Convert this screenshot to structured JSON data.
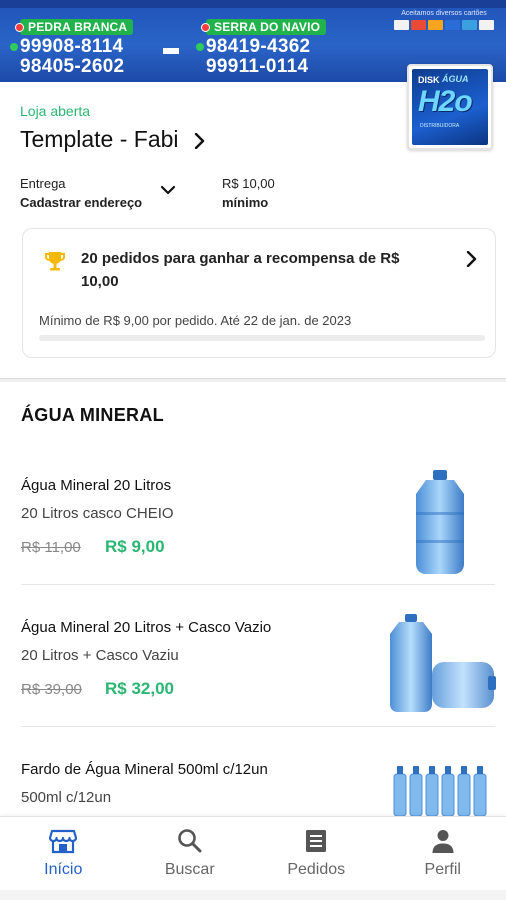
{
  "banner": {
    "left": {
      "city": "PEDRA BRANCA",
      "phones": [
        "99908-8114",
        "98405-2602"
      ]
    },
    "right": {
      "city": "SERRA DO NAVIO",
      "phones": [
        "98419-4362",
        "99911-0114"
      ]
    },
    "cards_caption": "Aceitamos diversos cartões",
    "card_colors": [
      "#f2f2f2",
      "#e94b35",
      "#f7a51e",
      "#2a6dd9",
      "#3aa0e0",
      "#f2f2f2"
    ]
  },
  "logo": {
    "line1": "DISK",
    "line2": "ÁGUA",
    "big": "H2o",
    "sub": "DISTRIBUIDORA"
  },
  "store": {
    "status": "Loja aberta",
    "name": "Template - Fabi",
    "delivery_label": "Entrega",
    "delivery_action": "Cadastrar endereço",
    "min_value": "R$ 10,00",
    "min_label": "mínimo"
  },
  "reward": {
    "title": "20 pedidos para ganhar a recompensa de R$ 10,00",
    "note": "Mínimo de R$ 9,00 por pedido. Até 22 de jan. de 2023",
    "progress": 0
  },
  "section": {
    "title": "ÁGUA MINERAL"
  },
  "products": [
    {
      "name": "Água Mineral 20 Litros",
      "desc": "20 Litros casco CHEIO",
      "old_price": "R$ 11,00",
      "price": "R$ 9,00"
    },
    {
      "name": "Água Mineral 20 Litros + Casco Vazio",
      "desc": "20 Litros + Casco Vaziu",
      "old_price": "R$ 39,00",
      "price": "R$ 32,00"
    },
    {
      "name": "Fardo de Água Mineral 500ml c/12un",
      "desc": "500ml c/12un",
      "old_price": "",
      "price": ""
    }
  ],
  "nav": [
    {
      "label": "Início",
      "icon": "store-icon",
      "active": true
    },
    {
      "label": "Buscar",
      "icon": "search-icon",
      "active": false
    },
    {
      "label": "Pedidos",
      "icon": "orders-icon",
      "active": false
    },
    {
      "label": "Perfil",
      "icon": "person-icon",
      "active": false
    }
  ],
  "colors": {
    "accent": "#2361c9",
    "green": "#2bb673",
    "banner": "#2a64c7"
  }
}
